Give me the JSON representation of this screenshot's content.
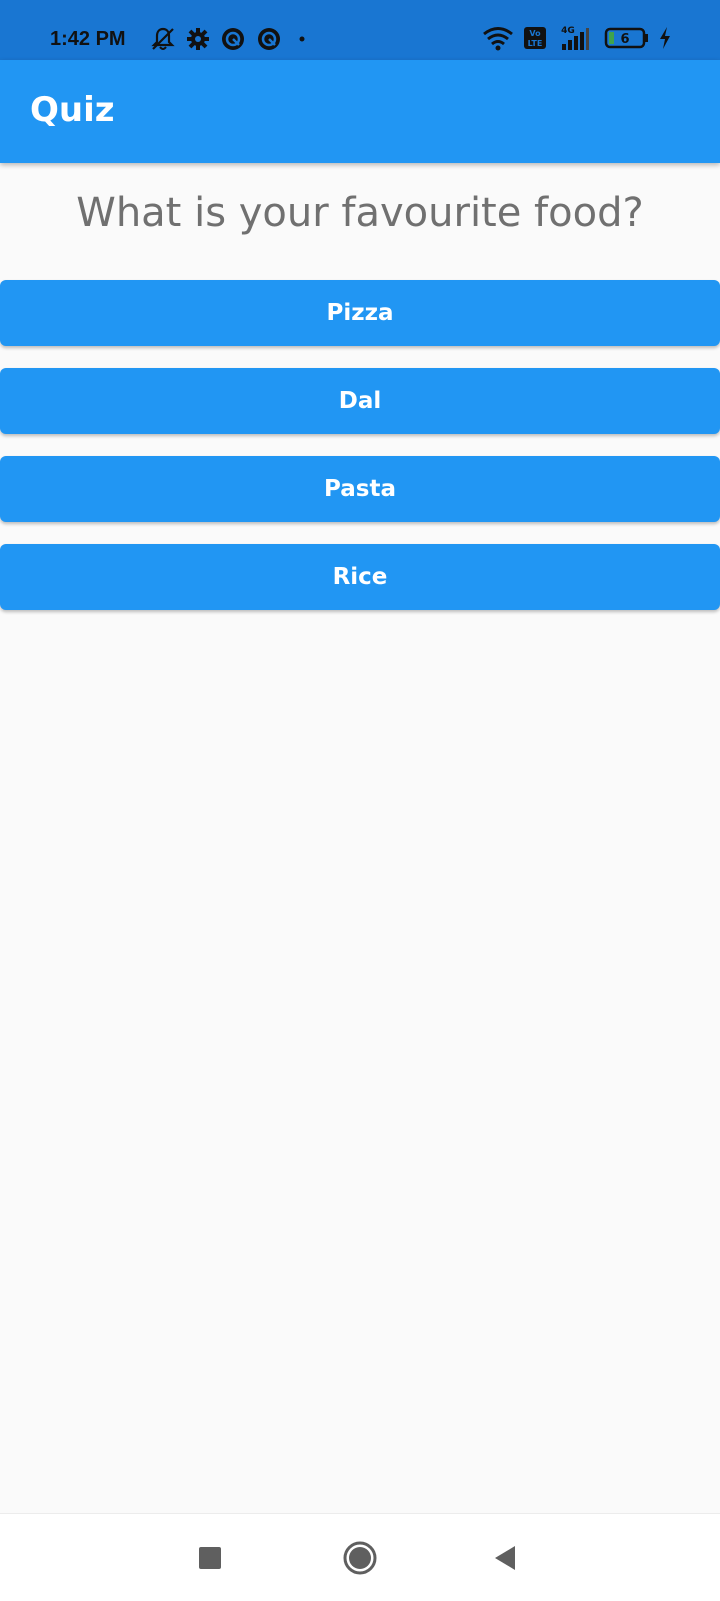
{
  "status_bar": {
    "time": "1:42 PM",
    "network_label": "4G",
    "volte_label": "Vo LTE",
    "battery_level": "6",
    "icons": [
      "mute-icon",
      "settings-icon",
      "sync-icon",
      "sync-icon",
      "dot-icon",
      "wifi-icon",
      "volte-icon",
      "signal-icon",
      "battery-icon",
      "charging-icon"
    ]
  },
  "app_bar": {
    "title": "Quiz"
  },
  "quiz": {
    "question": "What is your favourite food?",
    "answers": [
      "Pizza",
      "Dal",
      "Pasta",
      "Rice"
    ]
  },
  "nav_bar": {
    "icons": [
      "recents-icon",
      "home-icon",
      "back-icon"
    ]
  },
  "colors": {
    "primary": "#2196f3",
    "status_bar": "#1976d2",
    "background": "#fafafa",
    "question_text": "#707070",
    "button_text": "#ffffff"
  }
}
